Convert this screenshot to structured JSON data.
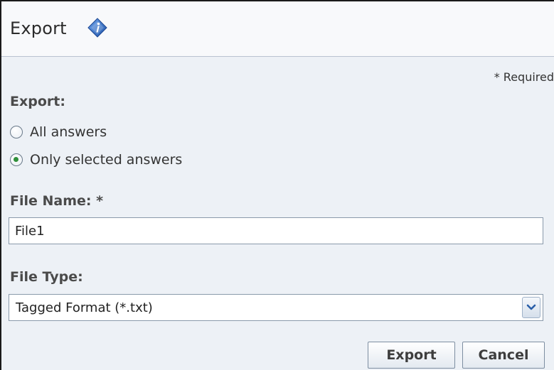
{
  "dialog": {
    "title": "Export",
    "title_icon": "info-icon",
    "required_note": "* Required"
  },
  "export_section": {
    "label": "Export:",
    "options": [
      {
        "label": "All answers",
        "selected": false
      },
      {
        "label": "Only selected answers",
        "selected": true
      }
    ]
  },
  "file_name": {
    "label": "File Name: *",
    "value": "File1"
  },
  "file_type": {
    "label": "File Type:",
    "selected": "Tagged Format (*.txt)",
    "arrow_icon": "chevron-down-icon"
  },
  "buttons": {
    "export_label": "Export",
    "cancel_label": "Cancel"
  },
  "colors": {
    "background": "#edf1f6",
    "header_background": "#f8f9fb",
    "radio_selected": "#2f8f3a",
    "info_icon": "#2b62b8"
  }
}
